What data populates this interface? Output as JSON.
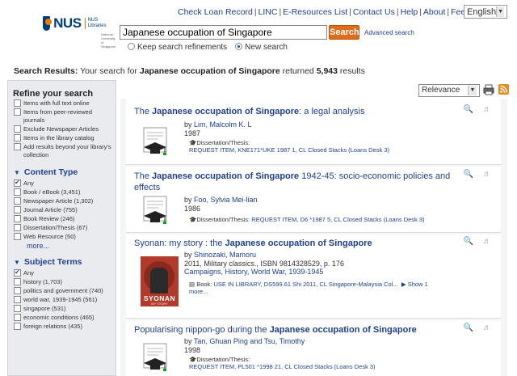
{
  "header": {
    "logo_text": "NUS",
    "logo_sub": "NUS Libraries",
    "logo_tagline": "National University of Singapore",
    "top_links": [
      "Check Loan Record",
      "LINC",
      "E-Resources List",
      "Contact Us",
      "Help",
      "About",
      "Feedback"
    ],
    "language": "English"
  },
  "search": {
    "query": "Japanese occupation of Singapore",
    "button_label": "Search",
    "advanced_label": "Advanced search",
    "radio_keep": "Keep search refinements",
    "radio_new": "New search"
  },
  "results_summary": {
    "prefix": "Search Results:",
    "mid": "Your search for",
    "query": "Japanese occupation of Singapore",
    "returned": "returned",
    "count": "5,943",
    "suffix": "results"
  },
  "sidebar": {
    "refine_title": "Refine your search",
    "refine_options": [
      {
        "label": "Items with full text online",
        "checked": false
      },
      {
        "label": "Items from peer-reviewed journals",
        "checked": false
      },
      {
        "label": "Exclude Newspaper Articles",
        "checked": false
      },
      {
        "label": "Items in the library catalog",
        "checked": false
      },
      {
        "label": "Add results beyond your library's collection",
        "checked": false
      }
    ],
    "content_type_title": "Content Type",
    "content_types": [
      {
        "label": "Any",
        "checked": true
      },
      {
        "label": "Book / eBook (3,451)",
        "checked": false
      },
      {
        "label": "Newspaper Article (1,302)",
        "checked": false
      },
      {
        "label": "Journal Article (755)",
        "checked": false
      },
      {
        "label": "Book Review (246)",
        "checked": false
      },
      {
        "label": "Dissertation/Thesis (67)",
        "checked": false
      },
      {
        "label": "Web Resource (50)",
        "checked": false
      }
    ],
    "more_label": "more...",
    "subject_terms_title": "Subject Terms",
    "subject_terms": [
      {
        "label": "Any",
        "checked": true
      },
      {
        "label": "history (1,703)",
        "checked": false
      },
      {
        "label": "politics and government (740)",
        "checked": false
      },
      {
        "label": "world war, 1939-1945 (561)",
        "checked": false
      },
      {
        "label": "singapore (531)",
        "checked": false
      },
      {
        "label": "economic conditions (465)",
        "checked": false
      },
      {
        "label": "foreign relations (435)",
        "checked": false
      }
    ]
  },
  "toolbar": {
    "sort_value": "Relevance"
  },
  "results": [
    {
      "title_pre": "The ",
      "title_bold": "Japanese occupation of Singapore",
      "title_post": ": a legal analysis",
      "by": "by",
      "author": "Lim, Malcolm K. L",
      "year": "1987",
      "type": "Dissertation/Thesis:",
      "availability": "REQUEST ITEM, KNE171*UKE 1987 1, CL Closed Stacks (Loans Desk 3)"
    },
    {
      "title_pre": "The ",
      "title_bold": "Japanese occupation of Singapore",
      "title_post": " 1942-45: socio-economic policies and effects",
      "by": "by",
      "author": "Foo, Sylvia Mei-lian",
      "year": "1986",
      "type": "Dissertation/Thesis:",
      "availability": "REQUEST ITEM, D6 *1987 5, CL Closed Stacks (Loans Desk 3)"
    },
    {
      "title_pre": "Syonan: my story : the ",
      "title_bold": "Japanese occupation of Singapore",
      "title_post": "",
      "by": "by",
      "author": "Shinozaki, Mamoru",
      "publication": "2011, Military classics., ISBN 9814328529, p. 176",
      "subjects": "Campaigns, History, World War, 1939-1945",
      "type": "Book:",
      "availability": "USE IN LIBRARY, DS599.61 Shi 2011, CL Singapore-Malaysia Col...",
      "show_label": "Show 1",
      "more_label": "more...",
      "cover_title": "SYONAN",
      "cover_sub": "MY STORY"
    },
    {
      "title_pre": "Popularising nippon-go during the ",
      "title_bold": "Japanese occupation of Singapore",
      "title_post": "",
      "by": "by",
      "author": "Tan, Ghuan Ping and Tsu, Timothy",
      "year": "1998",
      "type": "Dissertation/Thesis:",
      "availability": "REQUEST ITEM, PL501 *1998 21, CL Closed Stacks (Loans Desk 3)"
    }
  ]
}
